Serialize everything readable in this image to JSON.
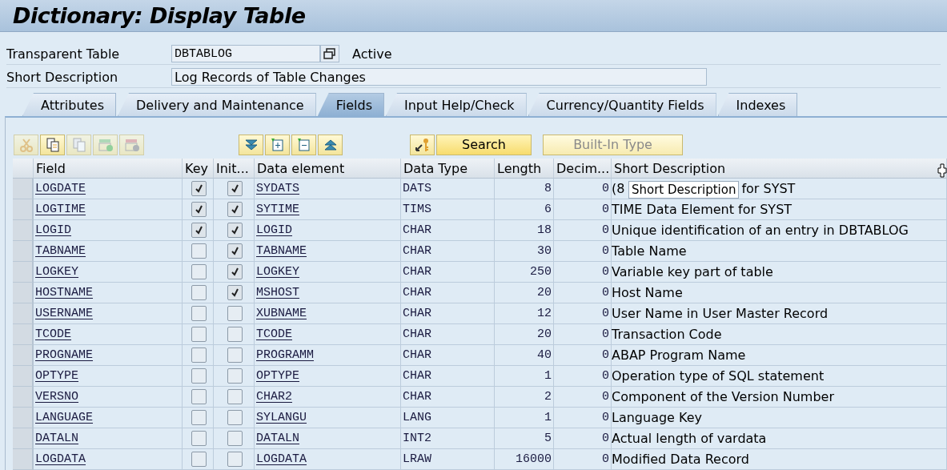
{
  "window": {
    "title": "Dictionary: Display Table"
  },
  "header": {
    "table_label": "Transparent Table",
    "table_value": "DBTABLOG",
    "status": "Active",
    "desc_label": "Short Description",
    "desc_value": "Log Records of Table Changes"
  },
  "tabs": [
    {
      "label": "Attributes",
      "selected": false
    },
    {
      "label": "Delivery and Maintenance",
      "selected": false
    },
    {
      "label": "Fields",
      "selected": true
    },
    {
      "label": "Input Help/Check",
      "selected": false
    },
    {
      "label": "Currency/Quantity Fields",
      "selected": false
    },
    {
      "label": "Indexes",
      "selected": false
    }
  ],
  "toolbar": {
    "search_button": "Search",
    "builtin_button": "Built-In Type"
  },
  "table": {
    "columns": [
      "Field",
      "Key",
      "Init...",
      "Data element",
      "Data Type",
      "Length",
      "Decim...",
      "Short Description"
    ],
    "rows": [
      {
        "field": "LOGDATE",
        "key": true,
        "initial": true,
        "data_element": "SYDATS",
        "data_type": "DATS",
        "length": "8",
        "decimals": "0",
        "description_parts": [
          "(8",
          "for SYST"
        ]
      },
      {
        "field": "LOGTIME",
        "key": true,
        "initial": true,
        "data_element": "SYTIME",
        "data_type": "TIMS",
        "length": "6",
        "decimals": "0",
        "description": "TIME Data Element for SYST"
      },
      {
        "field": "LOGID",
        "key": true,
        "initial": true,
        "data_element": "LOGID",
        "data_type": "CHAR",
        "length": "18",
        "decimals": "0",
        "description": "Unique identification of an entry in DBTABLOG"
      },
      {
        "field": "TABNAME",
        "key": false,
        "initial": true,
        "data_element": "TABNAME",
        "data_type": "CHAR",
        "length": "30",
        "decimals": "0",
        "description": "Table Name"
      },
      {
        "field": "LOGKEY",
        "key": false,
        "initial": true,
        "data_element": "LOGKEY",
        "data_type": "CHAR",
        "length": "250",
        "decimals": "0",
        "description": "Variable key part of table"
      },
      {
        "field": "HOSTNAME",
        "key": false,
        "initial": true,
        "data_element": "MSHOST",
        "data_type": "CHAR",
        "length": "20",
        "decimals": "0",
        "description": "Host Name"
      },
      {
        "field": "USERNAME",
        "key": false,
        "initial": false,
        "data_element": "XUBNAME",
        "data_type": "CHAR",
        "length": "12",
        "decimals": "0",
        "description": "User Name in User Master Record"
      },
      {
        "field": "TCODE",
        "key": false,
        "initial": false,
        "data_element": "TCODE",
        "data_type": "CHAR",
        "length": "20",
        "decimals": "0",
        "description": "Transaction Code"
      },
      {
        "field": "PROGNAME",
        "key": false,
        "initial": false,
        "data_element": "PROGRAMM",
        "data_type": "CHAR",
        "length": "40",
        "decimals": "0",
        "description": "ABAP Program Name"
      },
      {
        "field": "OPTYPE",
        "key": false,
        "initial": false,
        "data_element": "OPTYPE",
        "data_type": "CHAR",
        "length": "1",
        "decimals": "0",
        "description": "Operation type of SQL statement"
      },
      {
        "field": "VERSNO",
        "key": false,
        "initial": false,
        "data_element": "CHAR2",
        "data_type": "CHAR",
        "length": "2",
        "decimals": "0",
        "description": "Component of the Version Number"
      },
      {
        "field": "LANGUAGE",
        "key": false,
        "initial": false,
        "data_element": "SYLANGU",
        "data_type": "LANG",
        "length": "1",
        "decimals": "0",
        "description": "Language Key"
      },
      {
        "field": "DATALN",
        "key": false,
        "initial": false,
        "data_element": "DATALN",
        "data_type": "INT2",
        "length": "5",
        "decimals": "0",
        "description": "Actual length of vardata"
      },
      {
        "field": "LOGDATA",
        "key": false,
        "initial": false,
        "data_element": "LOGDATA",
        "data_type": "LRAW",
        "length": "16000",
        "decimals": "0",
        "description": "Modified Data Record"
      }
    ]
  },
  "tooltip": {
    "text": "Short Description"
  }
}
